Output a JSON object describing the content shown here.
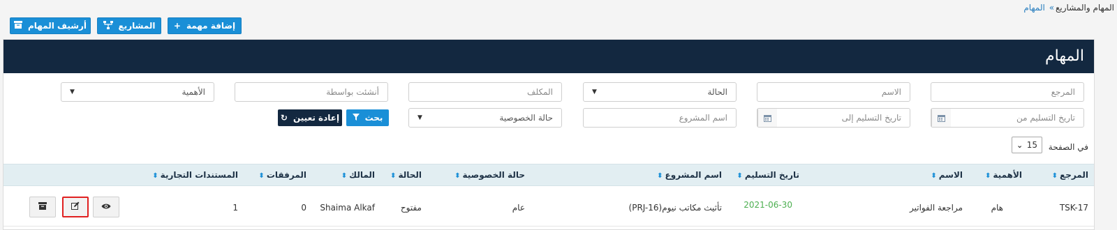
{
  "breadcrumb": {
    "root": "المهام والمشاريع",
    "separator": "»",
    "current": "المهام"
  },
  "toolbar": {
    "add_task": "إضافة مهمة",
    "projects": "المشاريع",
    "archive": "أرشيف المهام"
  },
  "page": {
    "title": "المهام"
  },
  "filters": {
    "reference": "المرجع",
    "name": "الاسم",
    "status": "الحالة",
    "assignee": "المكلف",
    "created_by": "أنشئت بواسطة",
    "importance": "الأهمية",
    "delivery_from": "تاريخ التسليم من",
    "delivery_to": "تاريخ التسليم  إلى",
    "project_name": "اسم المشروع",
    "privacy_status": "حالة الخصوصية",
    "search_button": "بحث",
    "reset_button": "إعادة تعيين"
  },
  "pagination": {
    "per_page_label": "في الصفحة",
    "per_page_value": "15"
  },
  "table": {
    "columns": {
      "reference": "المرجع",
      "importance": "الأهمية",
      "name": "الاسم",
      "delivery_date": "تاريخ التسليم",
      "project_name": "اسم المشروع",
      "privacy": "حالة الخصوصية",
      "status": "الحالة",
      "owner": "المالك",
      "attachments": "المرفقات",
      "commercial_docs": "المستندات التجارية"
    },
    "rows": [
      {
        "reference": "TSK-17",
        "importance": "هام",
        "name": "مراجعة الفواتير",
        "delivery_date": "2021-06-30",
        "project_name": "تأثيث مكاتب نيوم(PRJ-16)",
        "privacy": "عام",
        "status": "مفتوح",
        "owner": "Shaima Alkaf",
        "attachments": "0",
        "commercial_docs": "1"
      }
    ]
  },
  "colors": {
    "header_bg": "#132840",
    "accent_blue": "#1a8fd7",
    "date_green": "#4caf50",
    "highlight_red": "#e02020"
  }
}
